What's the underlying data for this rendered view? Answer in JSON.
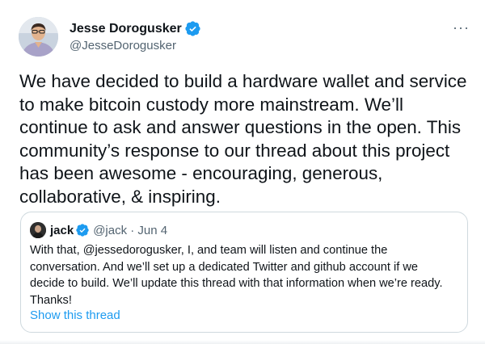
{
  "tweet": {
    "author": {
      "name": "Jesse Dorogusker",
      "handle": "@JesseDorogusker",
      "avatar_icon": "profile-photo"
    },
    "more_label": "···",
    "text_lines": [
      "We have decided to build a hardware wallet and service",
      "to make bitcoin custody more mainstream. We’ll",
      "continue to ask and answer questions in the open. This",
      "community’s response to our thread about this project",
      "has been awesome - encouraging, generous,",
      "collaborative, & inspiring."
    ]
  },
  "quoted_tweet": {
    "author": {
      "name": "jack",
      "handle_date": "@jack · Jun 4",
      "avatar_icon": "profile-photo"
    },
    "text_lines": [
      "With that, @jessedorogusker, I, and team will listen and continue the",
      "conversation. And we’ll set up a dedicated Twitter and github account if we",
      "decide to build. We’ll update this thread with that information when we’re ready.",
      "Thanks!"
    ],
    "show_thread_label": "Show this thread"
  },
  "colors": {
    "verified": "#1d9bf0",
    "link": "#1d9bf0",
    "secondary_text": "#536471",
    "border": "#cfd9de"
  }
}
